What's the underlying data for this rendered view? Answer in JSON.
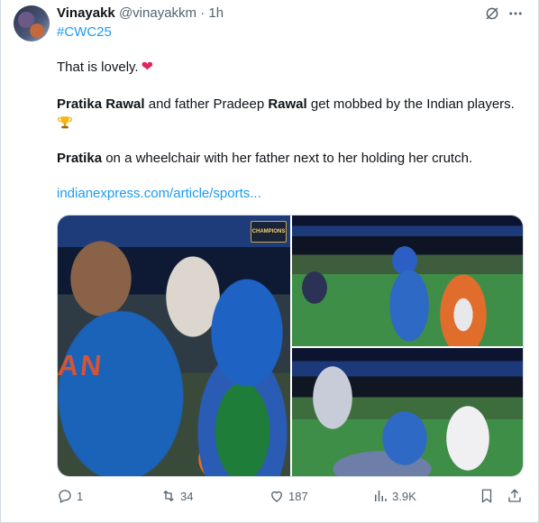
{
  "author": {
    "name": "Vinayakk",
    "handle": "@vinayakkm",
    "separator": "·",
    "time": "1h",
    "avatar_icon": "user-avatar"
  },
  "hashtag": "#CWC25",
  "body": {
    "line1": "That is lovely.",
    "line1_emoji": "❤",
    "line2_parts": [
      {
        "text": "Pratika Rawal",
        "bold": true
      },
      {
        "text": " and father Pradeep ",
        "bold": false
      },
      {
        "text": "Rawal",
        "bold": true
      },
      {
        "text": " get mobbed by the Indian players.",
        "bold": false
      }
    ],
    "trophy_icon": "trophy-icon",
    "line3_parts": [
      {
        "text": "Pratika",
        "bold": true
      },
      {
        "text": " on a wheelchair with her father next to her holding her crutch.",
        "bold": false
      }
    ],
    "link": "indianexpress.com/article/sports..."
  },
  "media": {
    "photo_count": 3,
    "photo1_caption_text": "CHAMPIONS"
  },
  "actions": {
    "replies": "1",
    "reposts": "34",
    "likes": "187",
    "views": "3.9K"
  },
  "colors": {
    "accent": "#1d9bf0",
    "heart": "#e0245e",
    "muted": "#536471",
    "text": "#0f1419"
  }
}
